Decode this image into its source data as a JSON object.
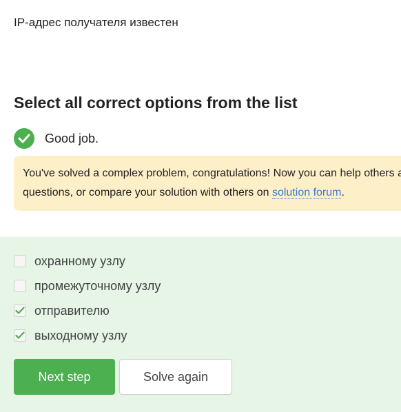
{
  "question": {
    "text": "IP-адрес получателя известен"
  },
  "section": {
    "title": "Select all correct options from the list"
  },
  "feedback": {
    "icon": "check-circle-icon",
    "text": "Good job."
  },
  "hint": {
    "line1": "You've solved a complex problem, congratulations! Now you can help others answering their",
    "line2_prefix": "questions, or compare your solution with others on ",
    "link_text": "solution forum",
    "line2_suffix": "."
  },
  "options": [
    {
      "label": "охранному узлу",
      "checked": false
    },
    {
      "label": "промежуточному узлу",
      "checked": false
    },
    {
      "label": "отправителю",
      "checked": true
    },
    {
      "label": "выходному узлу",
      "checked": true
    }
  ],
  "buttons": {
    "next": "Next step",
    "solve_again": "Solve again"
  },
  "colors": {
    "accent_green": "#4caf50",
    "hint_background": "#fdefc8",
    "options_background": "#e6f5e6",
    "link": "#3a7bd5"
  }
}
